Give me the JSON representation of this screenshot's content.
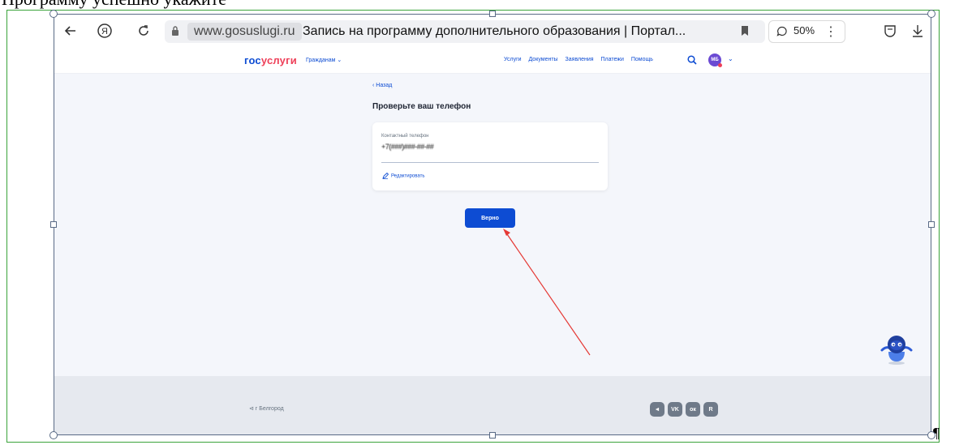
{
  "document": {
    "caption_fragment": "Программу успешно укажите",
    "pilcrow": "¶"
  },
  "browser": {
    "domain": "www.gosuslugi.ru",
    "page_title": "Запись на программу дополнительного образования | Портал...",
    "zoom": "50%",
    "menu_dots": "⋮"
  },
  "site": {
    "logo_gos": "гос",
    "logo_uslugi": "услуги",
    "audience": "Гражданам ⌄",
    "nav": [
      "Услуги",
      "Документы",
      "Заявления",
      "Платежи",
      "Помощь"
    ],
    "avatar_initials": "МБ",
    "avatar_chevron": "⌄"
  },
  "main": {
    "back": "‹ Назад",
    "title": "Проверьте ваш телефон",
    "phone_label": "Контактный телефон",
    "phone_value": "+7(###)###-##-##",
    "edit": "Редактировать",
    "confirm": "Верно"
  },
  "footer": {
    "city": "⊲ г Белгород",
    "socials": [
      "◄",
      "VK",
      "ок",
      "R"
    ]
  },
  "colors": {
    "accent": "#0d4cd3",
    "arrow": "#e53935",
    "page_border": "#3aa33a"
  }
}
